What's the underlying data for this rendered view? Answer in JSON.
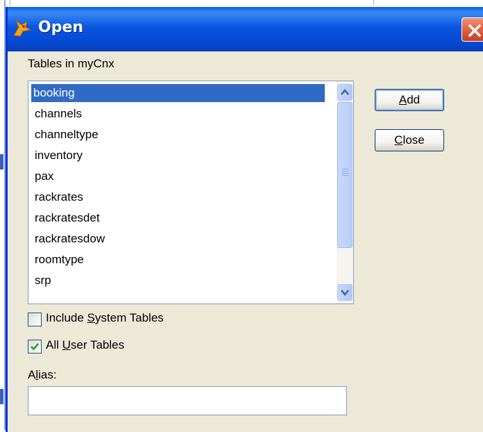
{
  "window": {
    "title": "Open",
    "icon": "fox-icon",
    "close_icon": "close-icon"
  },
  "tables_label": "Tables in myCnx",
  "tables": {
    "items": [
      "booking",
      "channels",
      "channeltype",
      "inventory",
      "pax",
      "rackrates",
      "rackratesdet",
      "rackratesdow",
      "roomtype",
      "srp"
    ],
    "selected": "booking"
  },
  "buttons": {
    "add": {
      "mnemonic": "A",
      "rest": "dd"
    },
    "close": {
      "mnemonic": "C",
      "rest": "lose"
    }
  },
  "options": {
    "include_system_tables": {
      "before": "Include ",
      "mnemonic": "S",
      "after": "ystem Tables",
      "checked": false
    },
    "all_user_tables": {
      "before": "All ",
      "mnemonic": "U",
      "after": "ser Tables",
      "checked": true
    }
  },
  "alias": {
    "label_before": "A",
    "label_mnemonic": "l",
    "label_after": "ias:",
    "value": ""
  },
  "colors": {
    "titlebar": "#0a57e0",
    "selection": "#316ac5",
    "dialog_bg": "#ece9d8",
    "close_button": "#e26a4b"
  }
}
